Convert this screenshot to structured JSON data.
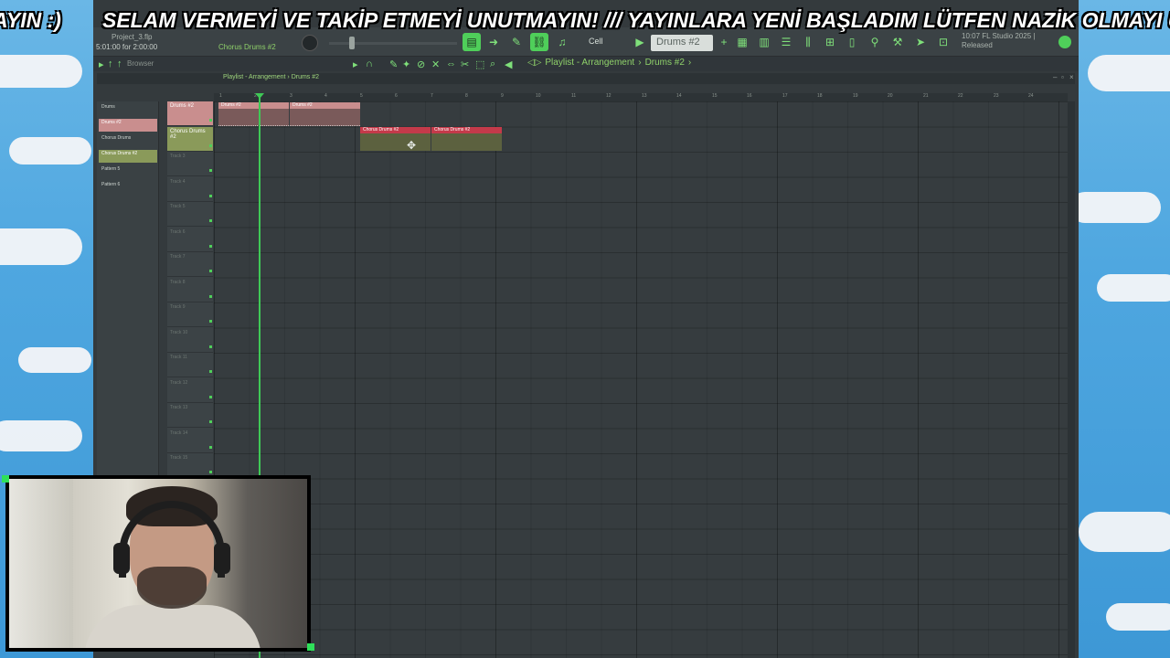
{
  "marquee": {
    "left_fragment": "AYIN :)",
    "message": "SELAM VERMEYİ VE TAKİP ETMEYİ UNUTMAYIN!  ///  YAYINLARA YENİ BAŞLADIM LÜTFEN NAZİK OLMAYI UN"
  },
  "toolbar": {
    "project_name": "Project_3.flp",
    "time_info": "5:01:00 for 2:00:00",
    "current_pattern": "Chorus Drums #2",
    "snap_label": "Cell",
    "pattern_select": "Drums #2",
    "version_line1": "10:07  FL Studio 2025 |",
    "version_line2": "Released"
  },
  "browser": {
    "label": "Browser"
  },
  "breadcrumb": {
    "part1": "Playlist - Arrangement",
    "sep": "›",
    "part2": "Drums #2",
    "end": "›"
  },
  "playlist_title": "Playlist - Arrangement › Drums #2",
  "patterns": [
    {
      "name": "Drums"
    },
    {
      "name": "Drums #2"
    },
    {
      "name": "Chorus Drums"
    },
    {
      "name": "Chorus Drums #2"
    },
    {
      "name": "Pattern 5"
    },
    {
      "name": "Pattern 6"
    }
  ],
  "tracks": [
    {
      "label": "Drums #2"
    },
    {
      "label": "Chorus Drums #2"
    },
    {
      "label": "Track 3"
    },
    {
      "label": "Track 4"
    },
    {
      "label": "Track 5"
    },
    {
      "label": "Track 6"
    },
    {
      "label": "Track 7"
    },
    {
      "label": "Track 8"
    },
    {
      "label": "Track 9"
    },
    {
      "label": "Track 10"
    },
    {
      "label": "Track 11"
    },
    {
      "label": "Track 12"
    },
    {
      "label": "Track 13"
    },
    {
      "label": "Track 14"
    },
    {
      "label": "Track 15"
    }
  ],
  "timeline_ticks": [
    "1",
    "2",
    "3",
    "4",
    "5",
    "6",
    "7",
    "8",
    "9",
    "10",
    "11",
    "12",
    "13",
    "14",
    "15",
    "16",
    "17",
    "18",
    "19",
    "20",
    "21",
    "22",
    "23",
    "24"
  ],
  "clips": [
    {
      "label": "Drums #2"
    },
    {
      "label": "Drums #2"
    },
    {
      "label": "Chorus Drums #2"
    },
    {
      "label": "Chorus Drums #2"
    }
  ],
  "colors": {
    "accent": "#4fcf5a",
    "drums_clip": "#c98e8e",
    "chorus_clip": "#c43a4a",
    "chorus_track": "#8a9a5a"
  }
}
